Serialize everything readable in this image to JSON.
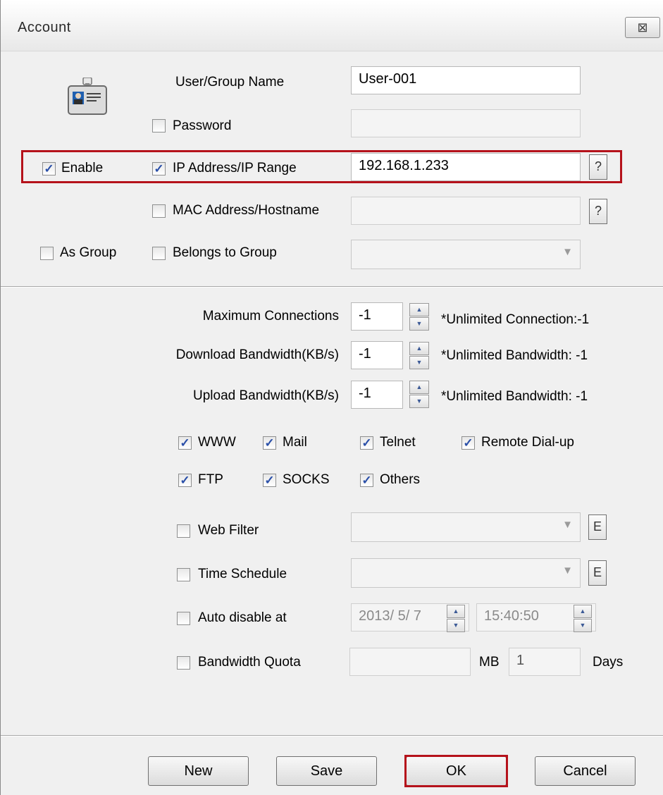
{
  "window": {
    "title": "Account",
    "close_glyph": "⊠"
  },
  "fields": {
    "user_group_name_label": "User/Group Name",
    "user_group_name_value": "User-001",
    "password_label": "Password",
    "enable_label": "Enable",
    "ip_label": "IP Address/IP Range",
    "ip_value": "192.168.1.233",
    "help_glyph": "?",
    "mac_label": "MAC Address/Hostname",
    "as_group_label": "As Group",
    "belongs_to_group_label": "Belongs to Group"
  },
  "limits": {
    "max_conn_label": "Maximum Connections",
    "max_conn_value": "-1",
    "max_conn_hint": "*Unlimited Connection:-1",
    "download_label": "Download Bandwidth(KB/s)",
    "download_value": "-1",
    "download_hint": "*Unlimited Bandwidth: -1",
    "upload_label": "Upload Bandwidth(KB/s)",
    "upload_value": "-1",
    "upload_hint": "*Unlimited Bandwidth: -1"
  },
  "services": {
    "www": "WWW",
    "mail": "Mail",
    "telnet": "Telnet",
    "remote_dialup": "Remote Dial-up",
    "ftp": "FTP",
    "socks": "SOCKS",
    "others": "Others"
  },
  "options": {
    "web_filter_label": "Web Filter",
    "time_schedule_label": "Time Schedule",
    "edit_glyph": "E",
    "auto_disable_label": "Auto disable at",
    "auto_disable_date": "2013/  5/  7",
    "auto_disable_time": "15:40:50",
    "bandwidth_quota_label": "Bandwidth Quota",
    "quota_unit": "MB",
    "days_value": "1",
    "days_label": "Days"
  },
  "buttons": {
    "new": "New",
    "save": "Save",
    "ok": "OK",
    "cancel": "Cancel"
  },
  "checkbox_glyph": "✓",
  "state": {
    "password": false,
    "enable": true,
    "ip_range": true,
    "mac": false,
    "as_group": false,
    "belongs_to_group": false,
    "www": true,
    "mail": true,
    "telnet": true,
    "remote_dialup": true,
    "ftp": true,
    "socks": true,
    "others": true,
    "web_filter": false,
    "time_schedule": false,
    "auto_disable": false,
    "bandwidth_quota": false
  },
  "colors": {
    "highlight": "#b5121b",
    "check": "#2a4fa8"
  }
}
